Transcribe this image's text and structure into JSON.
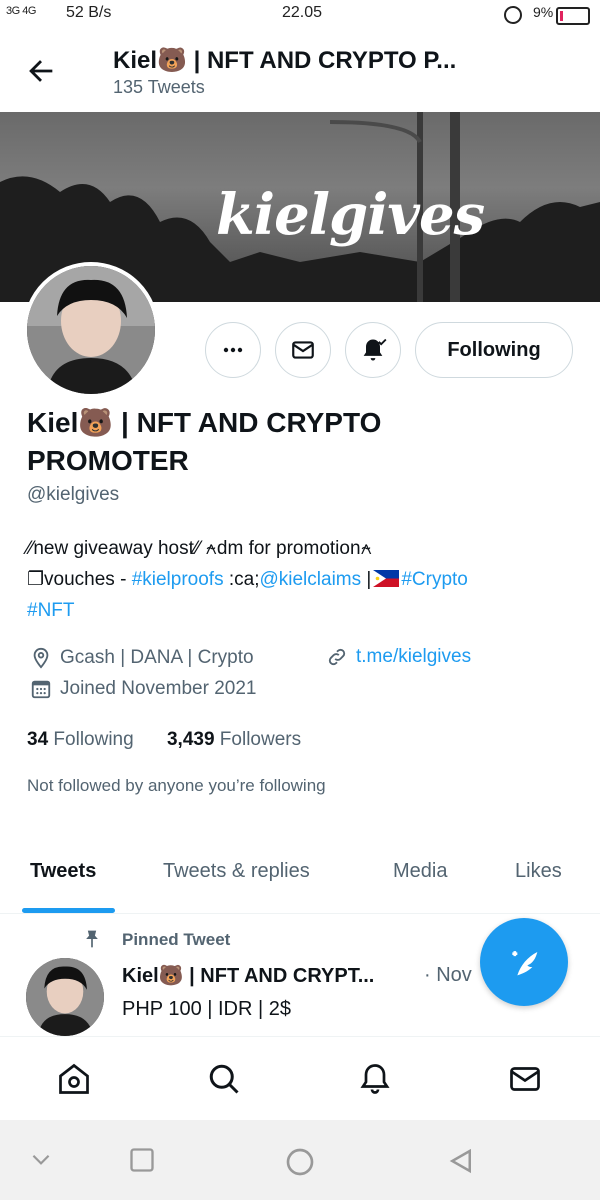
{
  "status_bar": {
    "signal": "3G 4G",
    "speed": "52 B/s",
    "time": "22.05",
    "battery_pct": "9%"
  },
  "header": {
    "title": "Kiel🐻 | NFT AND CRYPTO P...",
    "tweet_count": "135 Tweets"
  },
  "banner": {
    "text": "kielgives"
  },
  "profile": {
    "name": "Kiel🐻 | NFT AND CRYPTO PROMOTER",
    "handle": "@kielgives",
    "follow_button": "Following",
    "bio": {
      "line1": "⁄⁄new giveaway host⁄⁄ ⍲dm for promotion⍲",
      "line2_prefix": "❐vouches - ",
      "hashtag1": "#kielproofs",
      "line2_mid": " :ca;",
      "mention": "@kielclaims",
      "line2_sep": " |",
      "hashtag2": "#Crypto",
      "hashtag3": "#NFT"
    },
    "location": "Gcash | DANA | Crypto",
    "website": "t.me/kielgives",
    "joined": "Joined November 2021",
    "following_count": "34",
    "following_label": "Following",
    "followers_count": "3,439",
    "followers_label": "Followers",
    "not_followed": "Not followed by anyone you’re following"
  },
  "tabs": [
    "Tweets",
    "Tweets & replies",
    "Media",
    "Likes"
  ],
  "pinned": {
    "label": "Pinned Tweet",
    "name": "Kiel🐻 | NFT AND CRYPT...",
    "date": "· Nov",
    "text": "PHP 100 | IDR | 2$"
  },
  "colors": {
    "accent": "#1d9bf0",
    "text": "#0f1419",
    "secondary": "#536471"
  },
  "icons": [
    "back-arrow-icon",
    "more-icon",
    "mail-icon",
    "bell-icon",
    "location-icon",
    "link-icon",
    "calendar-icon",
    "pin-icon",
    "compose-icon",
    "home-icon",
    "search-icon",
    "notifications-icon",
    "messages-icon"
  ]
}
